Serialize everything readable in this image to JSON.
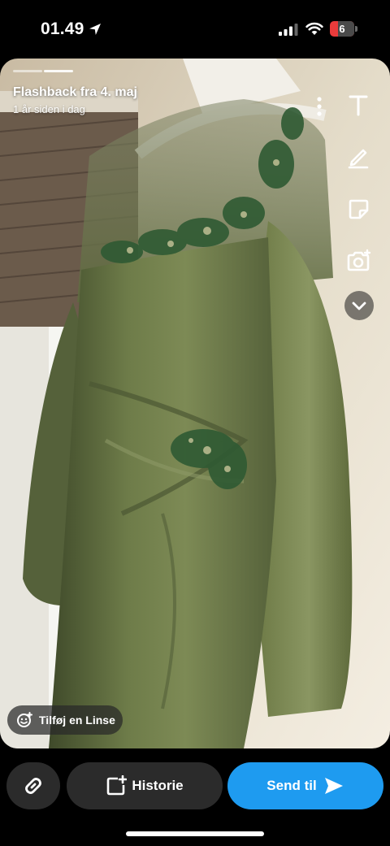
{
  "status_bar": {
    "time": "01.49",
    "battery_level": "6"
  },
  "snap": {
    "title": "Flashback fra 4. maj",
    "subtitle": "1 år siden i dag",
    "lens_button": "Tilføj en Linse"
  },
  "toolbar": {
    "icons": [
      "text-icon",
      "pen-icon",
      "sticker-icon",
      "camera-icon",
      "chevron-down-icon",
      "more-icon"
    ]
  },
  "bottom_bar": {
    "story_label": "Historie",
    "send_label": "Send til"
  },
  "colors": {
    "send_blue": "#1e9bf0",
    "button_dark": "#2b2b2b",
    "battery_red": "#ea3b3b",
    "dress_green": "#6e7c49"
  }
}
